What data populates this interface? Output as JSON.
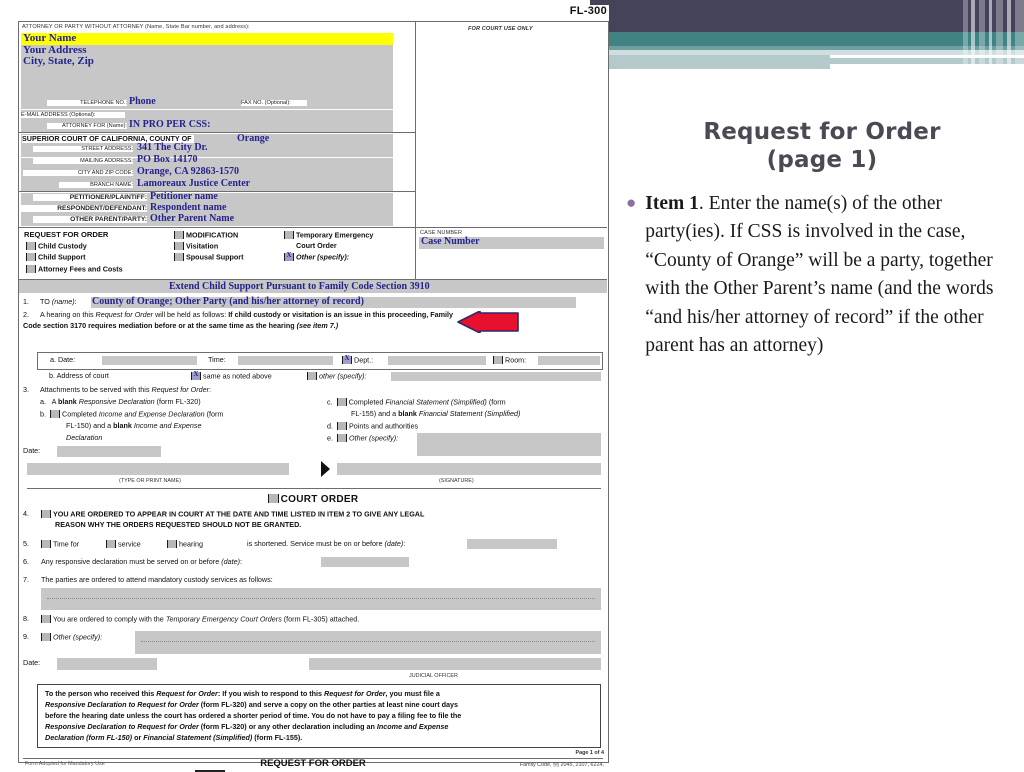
{
  "slide": {
    "title_line1": "Request for Order",
    "title_line2": "(page 1)",
    "bullet_lead": "Item 1",
    "bullet_text": ".  Enter the name(s) of the other party(ies).  If CSS is involved in the case, “County of Orange” will be a party, together with the Other Parent’s name (and the words “and his/her attorney of record” if the other parent has an attorney)",
    "accent_dark": "#454359",
    "accent_teal": "#418385",
    "accent_pale": "#b4c9ca",
    "bullet_color": "#8f6f9e"
  },
  "form": {
    "form_code": "FL-300",
    "attorney_caption": "ATTORNEY OR PARTY WITHOUT ATTORNEY (Name, State Bar number, and address):",
    "court_use_label": "FOR COURT USE ONLY",
    "your_name": "Your Name",
    "your_address": "Your Address",
    "city_state_zip": "City, State, Zip",
    "telephone_label": "TELEPHONE NO.:",
    "telephone_value": "Phone",
    "fax_label": "FAX NO. (Optional):",
    "email_label": "E-MAIL ADDRESS (Optional):",
    "attorney_for_label": "ATTORNEY FOR (Name):",
    "attorney_for_value": "IN PRO PER     CSS:",
    "superior_court_label": "SUPERIOR COURT OF CALIFORNIA, COUNTY OF",
    "county_value": "Orange",
    "street_label": "STREET ADDRESS:",
    "street_value": "341 The City Dr.",
    "mailing_label": "MAILING ADDRESS:",
    "mailing_value": "PO Box 14170",
    "cityzip_label": "CITY AND ZIP CODE:",
    "cityzip_value": "Orange, CA  92863-1570",
    "branch_label": "BRANCH NAME:",
    "branch_value": "Lamoreaux Justice Center",
    "petitioner_label": "PETITIONER/PLAINTIFF:",
    "petitioner_value": "Petitioner name",
    "respondent_label": "RESPONDENT/DEFENDANT:",
    "respondent_value": "Respondent name",
    "otherparent_label": "OTHER PARENT/PARTY:",
    "otherparent_value": "Other Parent Name",
    "rfo_title": "REQUEST FOR ORDER",
    "rfo_col1": [
      {
        "label": "Child Custody",
        "checked": false
      },
      {
        "label": "Child Support",
        "checked": false
      },
      {
        "label": "Attorney Fees and Costs",
        "checked": false
      }
    ],
    "rfo_col2_head": "MODIFICATION",
    "rfo_col2": [
      {
        "label": "Visitation",
        "checked": false
      },
      {
        "label": "Spousal Support",
        "checked": false
      }
    ],
    "rfo_col3_head_l1": "Temporary Emergency",
    "rfo_col3_head_l2": "Court Order",
    "rfo_other_label": "Other (specify):",
    "rfo_other_checked": true,
    "case_number_label": "CASE NUMBER",
    "case_number_value": "Case Number",
    "extend_text": "Extend Child Support Pursuant to Family Code Section 3910",
    "item1_num": "1.",
    "item1_lead": "TO (name):",
    "item1_value": "County of Orange; Other Party (and his/her attorney of record)",
    "item2_num": "2.",
    "item2_line1a": "A hearing on this ",
    "item2_line1b": "Request for Order",
    "item2_line1c": " will be held as follows: ",
    "item2_line1d": "If child custody or visitation is an issue in this proceeding, Family",
    "item2_line2a": "Code section 3170 requires mediation before or at the same time as the hearing ",
    "item2_line2b": "(see item 7.)",
    "hearing_a_label": "a.  Date:",
    "hearing_time_label": "Time:",
    "hearing_dept_label": "Dept.:",
    "hearing_dept_checked": true,
    "hearing_room_label": "Room:",
    "hearing_room_checked": false,
    "hearing_b_label": "b.  Address of court",
    "hearing_b_same": "same as noted above",
    "hearing_b_same_checked": true,
    "hearing_b_other": "other (specify):",
    "hearing_b_other_checked": false,
    "item3_num": "3.",
    "item3_lead_a": "Attachments to be served with this ",
    "item3_lead_b": "Request for Order",
    "item3_lead_c": ":",
    "item3_a": "a.   A blank Responsive Declaration (form FL-320)",
    "item3_b_l1": "Completed Income and Expense Declaration (form",
    "item3_b_l2": "FL-150) and a blank Income and Expense",
    "item3_b_l3": "Declaration",
    "item3_c_l1": "Completed Financial Statement (Simplified) (form",
    "item3_c_l2": "FL-155) and a blank Financial Statement (Simplified)",
    "item3_d": "Points and authorities",
    "item3_e": "Other (specify):",
    "date_label": "Date:",
    "typeprint_label": "(TYPE OR PRINT NAME)",
    "signature_label": "(SIGNATURE)",
    "court_order_heading": "COURT ORDER",
    "item4_num": "4.",
    "item4_l1": "YOU ARE ORDERED TO APPEAR IN COURT AT THE DATE AND TIME LISTED IN ITEM 2 TO GIVE ANY LEGAL",
    "item4_l2": "REASON WHY THE ORDERS REQUESTED SHOULD NOT BE GRANTED.",
    "item5_num": "5.",
    "item5_a": "Time for",
    "item5_b": "service",
    "item5_c": "hearing",
    "item5_d": "is shortened. Service must be on or before (date):",
    "item6_num": "6.",
    "item6_text": "Any responsive declaration must be served on or before (date):",
    "item7_num": "7.",
    "item7_text": "The parties are ordered to attend mandatory custody services as follows:",
    "item8_num": "8.",
    "item8_a": "You are ordered to comply with the ",
    "item8_b": "Temporary Emergency Court Orders",
    "item8_c": " (form FL-305) attached.",
    "item9_num": "9.",
    "item9_text": "Other (specify):",
    "judicial_officer_label": "JUDICIAL OFFICER",
    "notice_l1a": "To the person who received this ",
    "notice_l1b": "Request for Order",
    "notice_l1c": ": If you wish to respond to this ",
    "notice_l1d": "Request for Order",
    "notice_l1e": ", you must file a",
    "notice_l2a": "Responsive Declaration to Request for Order",
    "notice_l2b": " (form FL-320) and serve a copy on the other parties at least nine court days",
    "notice_l3": "before the hearing date unless the court has ordered a shorter period of time. You do not have to pay a filing fee to file the",
    "notice_l4a": "Responsive Declaration to Request for Order",
    "notice_l4b": " (form FL-320) or any other declaration including an ",
    "notice_l4c": "Income and Expense",
    "notice_l5a": "Declaration (form FL-150)",
    "notice_l5b": " or ",
    "notice_l5c": "Financial Statement (Simplified)",
    "notice_l5d": " (form FL-155).",
    "page_label": "Page 1 of 4",
    "footer_left": "Form Adopted for Mandatory Use",
    "footer_center": "REQUEST FOR ORDER",
    "footer_right": "Family Code, §§ 2045, 2107, 6224,"
  }
}
